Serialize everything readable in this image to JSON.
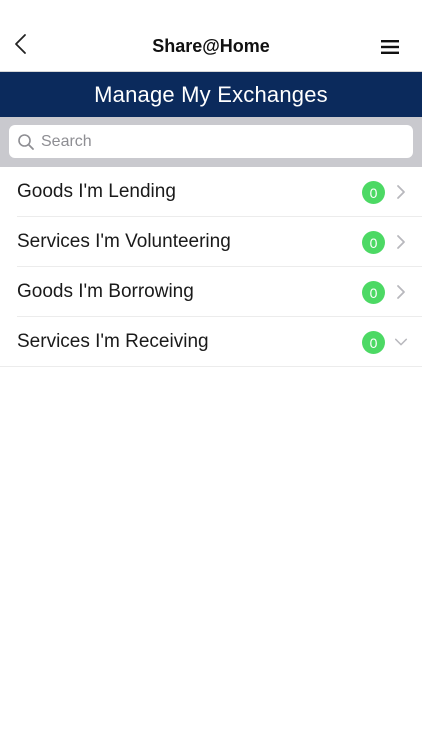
{
  "navbar": {
    "title": "Share@Home",
    "back_icon": "chevron-left-icon",
    "menu_icon": "hamburger-menu-icon"
  },
  "header": {
    "title": "Manage My Exchanges",
    "background_color": "#0b2a5c"
  },
  "search": {
    "placeholder": "Search",
    "value": "",
    "icon": "search-icon"
  },
  "list": {
    "items": [
      {
        "label": "Goods I'm Lending",
        "count": "0",
        "indicator": "chevron-right-icon"
      },
      {
        "label": "Services I'm Volunteering",
        "count": "0",
        "indicator": "chevron-right-icon"
      },
      {
        "label": "Goods I'm Borrowing",
        "count": "0",
        "indicator": "chevron-right-icon"
      },
      {
        "label": "Services I'm Receiving",
        "count": "0",
        "indicator": "chevron-down-icon"
      }
    ]
  },
  "colors": {
    "badge": "#4cd964",
    "accent": "#0b2a5c"
  }
}
